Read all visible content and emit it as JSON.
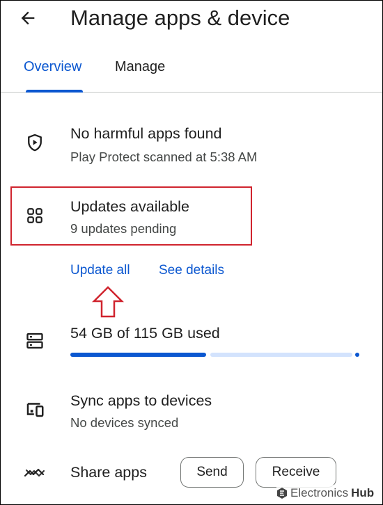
{
  "header": {
    "back_icon": "arrow-left-icon",
    "title": "Manage apps & device"
  },
  "tabs": [
    {
      "label": "Overview",
      "active": true
    },
    {
      "label": "Manage",
      "active": false
    }
  ],
  "protect": {
    "icon": "shield-play-icon",
    "title": "No harmful apps found",
    "subtitle": "Play Protect scanned at 5:38 AM"
  },
  "updates": {
    "icon": "apps-grid-icon",
    "title": "Updates available",
    "subtitle": "9 updates pending",
    "update_all_label": "Update all",
    "see_details_label": "See details"
  },
  "storage": {
    "icon": "storage-icon",
    "title": "54 GB of 115 GB used",
    "used_gb": 54,
    "total_gb": 115
  },
  "sync": {
    "icon": "devices-icon",
    "title": "Sync apps to devices",
    "subtitle": "No devices synced"
  },
  "share": {
    "icon": "share-nearby-icon",
    "title": "Share apps",
    "send_label": "Send",
    "receive_label": "Receive"
  },
  "watermark": {
    "brand_a": "Electronics",
    "brand_b": "Hub"
  },
  "colors": {
    "accent": "#0b57d0",
    "highlight": "#d0242e",
    "track": "#d3e3fd"
  }
}
